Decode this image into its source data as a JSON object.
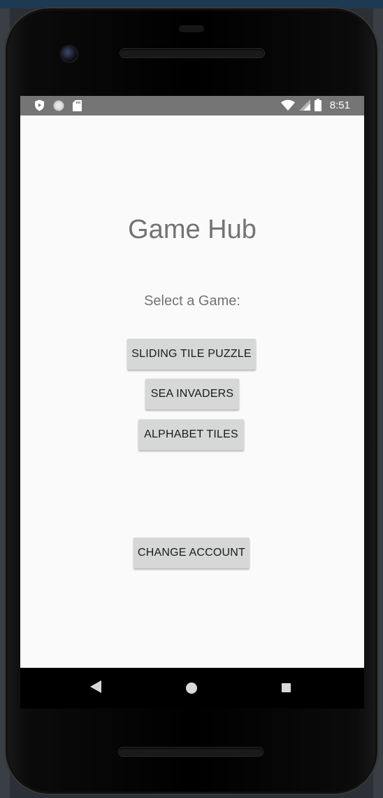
{
  "status_bar": {
    "time": "8:51",
    "left_icons": [
      "shield-icon",
      "circle-icon",
      "sd-card-icon"
    ],
    "right_icons": [
      "wifi-icon",
      "signal-icon",
      "battery-icon"
    ]
  },
  "app": {
    "title": "Game Hub",
    "subtitle": "Select a Game:",
    "games": [
      {
        "label": "SLIDING TILE PUZZLE"
      },
      {
        "label": "SEA INVADERS"
      },
      {
        "label": "ALPHABET TILES"
      }
    ],
    "change_account_label": "CHANGE ACCOUNT"
  },
  "nav_bar": {
    "buttons": [
      "back-icon",
      "home-icon",
      "recents-icon"
    ]
  },
  "colors": {
    "status_bar": "#757575",
    "background": "#fafafa",
    "button": "#d6d7d7",
    "text_secondary": "#737373"
  }
}
